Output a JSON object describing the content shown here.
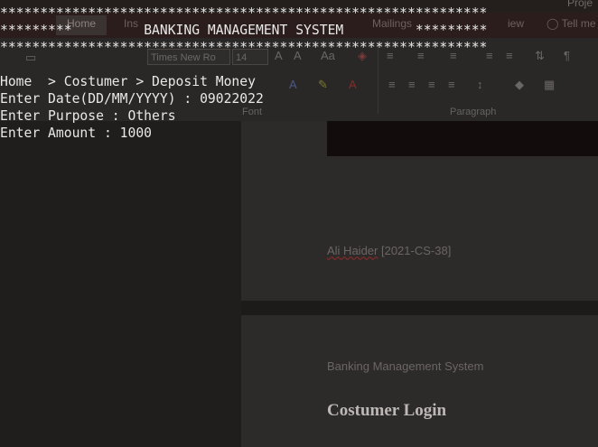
{
  "console": {
    "stars": "*************************************************************",
    "header_left": "*********",
    "header_title": "BANKING MANAGEMENT SYSTEM",
    "header_right": "*********",
    "breadcrumb": "Home  > Costumer > Deposit Money",
    "date_prompt": "Enter Date(DD/MM/YYYY) : ",
    "date_value": "09022022",
    "purpose_prompt": "Enter Purpose : ",
    "purpose_value": "Others",
    "amount_prompt": "Enter Amount : ",
    "amount_value": "1000"
  },
  "word": {
    "title_right": "Proje",
    "tabs": [
      "Home",
      "Ins",
      "Mailings",
      "iew",
      "Tell me"
    ],
    "font_name": "Times New Ro",
    "font_size": "14",
    "groups": {
      "font": "Font",
      "paragraph": "Paragraph"
    },
    "author_name": "Ali Haider",
    "author_id": "[2021-CS-38]",
    "doc_subtitle": "Banking Management System",
    "doc_heading": "Costumer Login"
  }
}
